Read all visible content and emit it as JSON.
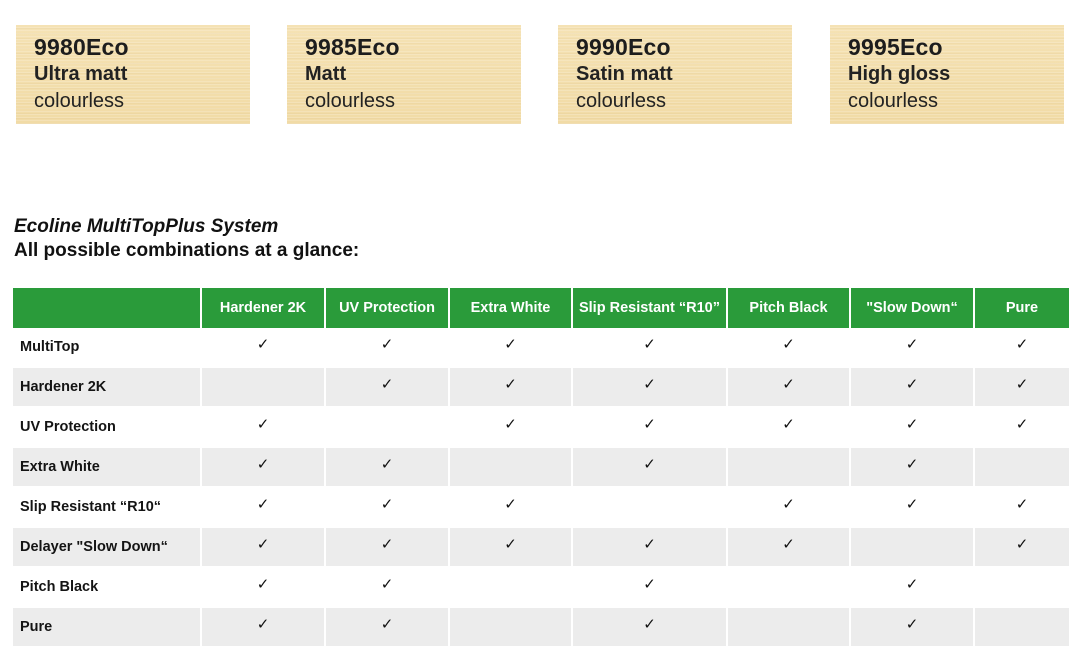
{
  "products": [
    {
      "code": "9980Eco",
      "finish": "Ultra matt",
      "color": "colourless"
    },
    {
      "code": "9985Eco",
      "finish": "Matt",
      "color": "colourless"
    },
    {
      "code": "9990Eco",
      "finish": "Satin matt",
      "color": "colourless"
    },
    {
      "code": "9995Eco",
      "finish": "High gloss",
      "color": "colourless"
    }
  ],
  "system": {
    "title": "Ecoline MultiTopPlus System",
    "subtitle": "All possible combinations at a glance:"
  },
  "table": {
    "header_color": "#2a9b3a",
    "check_symbol": "✓",
    "columns": [
      "",
      "Hardener 2K",
      "UV Protection",
      "Extra White",
      "Slip Resistant “R10”",
      "Pitch Black",
      "\"Slow Down“",
      "Pure"
    ],
    "rows": [
      {
        "label": "MultiTop",
        "checks": [
          true,
          true,
          true,
          true,
          true,
          true,
          true
        ]
      },
      {
        "label": "Hardener 2K",
        "checks": [
          false,
          true,
          true,
          true,
          true,
          true,
          true
        ]
      },
      {
        "label": "UV Protection",
        "checks": [
          true,
          false,
          true,
          true,
          true,
          true,
          true
        ]
      },
      {
        "label": "Extra White",
        "checks": [
          true,
          true,
          false,
          true,
          false,
          true,
          false
        ]
      },
      {
        "label": "Slip Resistant “R10“",
        "checks": [
          true,
          true,
          true,
          false,
          true,
          true,
          true
        ]
      },
      {
        "label": "Delayer \"Slow Down“",
        "checks": [
          true,
          true,
          true,
          true,
          true,
          false,
          true
        ]
      },
      {
        "label": "Pitch Black",
        "checks": [
          true,
          true,
          false,
          true,
          false,
          true,
          false
        ]
      },
      {
        "label": "Pure",
        "checks": [
          true,
          true,
          false,
          true,
          false,
          true,
          false
        ]
      }
    ]
  }
}
